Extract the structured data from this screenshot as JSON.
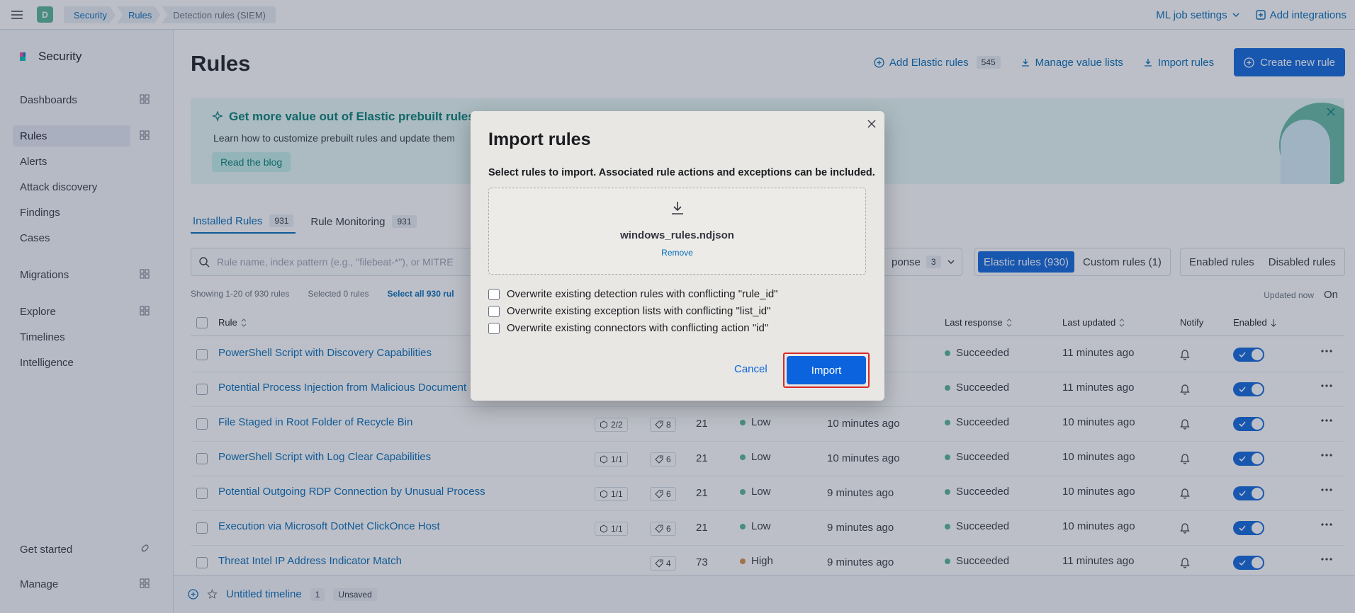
{
  "header": {
    "space_initial": "D",
    "breadcrumbs": [
      "Security",
      "Rules",
      "Detection rules (SIEM)"
    ],
    "ml_job_settings": "ML job settings",
    "add_integrations": "Add integrations"
  },
  "sidebar": {
    "brand": "Security",
    "items": [
      "Dashboards",
      "Rules",
      "Alerts",
      "Attack discovery",
      "Findings",
      "Cases",
      "Migrations",
      "Explore",
      "Timelines",
      "Intelligence"
    ],
    "bottom": [
      "Get started",
      "Manage"
    ]
  },
  "page": {
    "title": "Rules",
    "add_elastic_rules": "Add Elastic rules",
    "add_elastic_rules_count": "545",
    "manage_value_lists": "Manage value lists",
    "import_rules": "Import rules",
    "create_new_rule": "Create new rule"
  },
  "callout": {
    "title": "Get more value out of Elastic prebuilt rules!",
    "text": "Learn how to customize prebuilt rules and update them",
    "button": "Read the blog"
  },
  "tabs": [
    {
      "label": "Installed Rules",
      "count": "931"
    },
    {
      "label": "Rule Monitoring",
      "count": "931"
    }
  ],
  "filters": {
    "search_placeholder": "Rule name, index pattern (e.g., \"filebeat-*\"), or MITRE",
    "last_response": "ponse",
    "last_response_count": "3",
    "elastic_rules": "Elastic rules (930)",
    "custom_rules": "Custom rules (1)",
    "enabled_rules": "Enabled rules",
    "disabled_rules": "Disabled rules"
  },
  "status": {
    "showing": "Showing 1-20 of 930 rules",
    "selected": "Selected 0 rules",
    "select_all": "Select all 930 rul",
    "updated": "Updated now",
    "refresh": "On"
  },
  "table": {
    "columns": {
      "rule": "Rule",
      "last_response": "Last response",
      "last_updated": "Last updated",
      "notify": "Notify",
      "enabled": "Enabled"
    },
    "rows": [
      {
        "name": "PowerShell Script with Discovery Capabilities",
        "integrations": "",
        "tags": "",
        "risk": "",
        "severity": "",
        "severity_color": "",
        "last_run": "",
        "response": "Succeeded",
        "updated": "11 minutes ago"
      },
      {
        "name": "Potential Process Injection from Malicious Document",
        "integrations": "",
        "tags": "",
        "risk": "",
        "severity": "",
        "severity_color": "",
        "last_run": "",
        "response": "Succeeded",
        "updated": "11 minutes ago"
      },
      {
        "name": "File Staged in Root Folder of Recycle Bin",
        "integrations": "2/2",
        "tags": "8",
        "risk": "21",
        "severity": "Low",
        "severity_color": "#54b399",
        "last_run": "10 minutes ago",
        "response": "Succeeded",
        "updated": "10 minutes ago"
      },
      {
        "name": "PowerShell Script with Log Clear Capabilities",
        "integrations": "1/1",
        "tags": "6",
        "risk": "21",
        "severity": "Low",
        "severity_color": "#54b399",
        "last_run": "10 minutes ago",
        "response": "Succeeded",
        "updated": "10 minutes ago"
      },
      {
        "name": "Potential Outgoing RDP Connection by Unusual Process",
        "integrations": "1/1",
        "tags": "6",
        "risk": "21",
        "severity": "Low",
        "severity_color": "#54b399",
        "last_run": "9 minutes ago",
        "response": "Succeeded",
        "updated": "10 minutes ago"
      },
      {
        "name": "Execution via Microsoft DotNet ClickOnce Host",
        "integrations": "1/1",
        "tags": "6",
        "risk": "21",
        "severity": "Low",
        "severity_color": "#54b399",
        "last_run": "9 minutes ago",
        "response": "Succeeded",
        "updated": "10 minutes ago"
      },
      {
        "name": "Threat Intel IP Address Indicator Match",
        "integrations": "",
        "tags": "4",
        "risk": "73",
        "severity": "High",
        "severity_color": "#da8b45",
        "last_run": "9 minutes ago",
        "response": "Succeeded",
        "updated": "11 minutes ago"
      }
    ]
  },
  "timeline": {
    "title": "Untitled timeline",
    "count": "1",
    "status": "Unsaved"
  },
  "modal": {
    "title": "Import rules",
    "description": "Select rules to import. Associated rule actions and exceptions can be included.",
    "file_name": "windows_rules.ndjson",
    "remove": "Remove",
    "options": [
      "Overwrite existing detection rules with conflicting \"rule_id\"",
      "Overwrite existing exception lists with conflicting \"list_id\"",
      "Overwrite existing connectors with conflicting action \"id\""
    ],
    "cancel": "Cancel",
    "import": "Import"
  },
  "colors": {
    "primary": "#0b64dd",
    "link": "#006bb8",
    "success": "#54b399",
    "highlight": "#d72a2a"
  }
}
